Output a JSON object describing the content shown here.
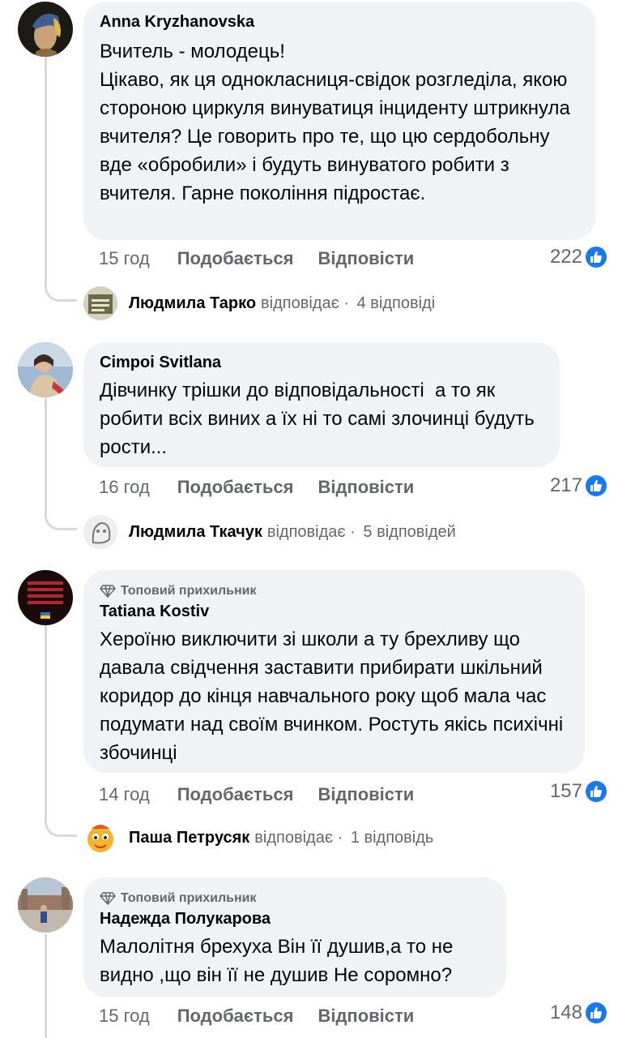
{
  "actions": {
    "like_label": "Подобається",
    "reply_label": "Відповісти",
    "replies_verb": "відповідає",
    "dot": " · "
  },
  "colors": {
    "bubble": "#f0f2f5",
    "secondary_text": "#65676b",
    "like_blue": "#1877f2"
  },
  "comments": [
    {
      "author": "Anna Kryzhanovska",
      "badge": "",
      "text": "Вчитель - молодець!\nЦікаво, як ця однокласниця-свідок розгледіла, якою стороною циркуля винуватиця інциденту штрикнула вчителя? Це говорить про те, що цю сердобольну вде «обробили» і будуть винуватого робити з вчителя. Гарне покоління підростає.",
      "time": "15 год",
      "reactions": "222",
      "reply_author": "Людмила Тарко",
      "reply_count": "4 відповіді"
    },
    {
      "author": "Cimpoi Svitlana",
      "badge": "",
      "text": "Дівчинку трішки до відповідальності  а то як робити всіх виних а їх ні то самі злочинці будуть рости...",
      "time": "16 год",
      "reactions": "217",
      "reply_author": "Людмила Ткачук",
      "reply_count": "5 відповідей"
    },
    {
      "author": "Tatiana Kostiv",
      "badge": "Топовий прихильник",
      "text": "Хероїню виключити зі школи а ту брехливу що давала свідчення заставити прибирати шкільний коридор до кінця навчального року щоб мала час подумати над своїм вчинком. Ростуть якісь психічні збочинці",
      "time": "14 год",
      "reactions": "157",
      "reply_author": "Паша Петрусяк",
      "reply_count": "1 відповідь"
    },
    {
      "author": "Надежда Полукарова",
      "badge": "Топовий прихильник",
      "text": "Малолітня брехуха Він її душив,а то не видно ,що він її не душив Не соромно?",
      "time": "15 год",
      "reactions": "148",
      "reply_author": "",
      "reply_count": ""
    }
  ]
}
